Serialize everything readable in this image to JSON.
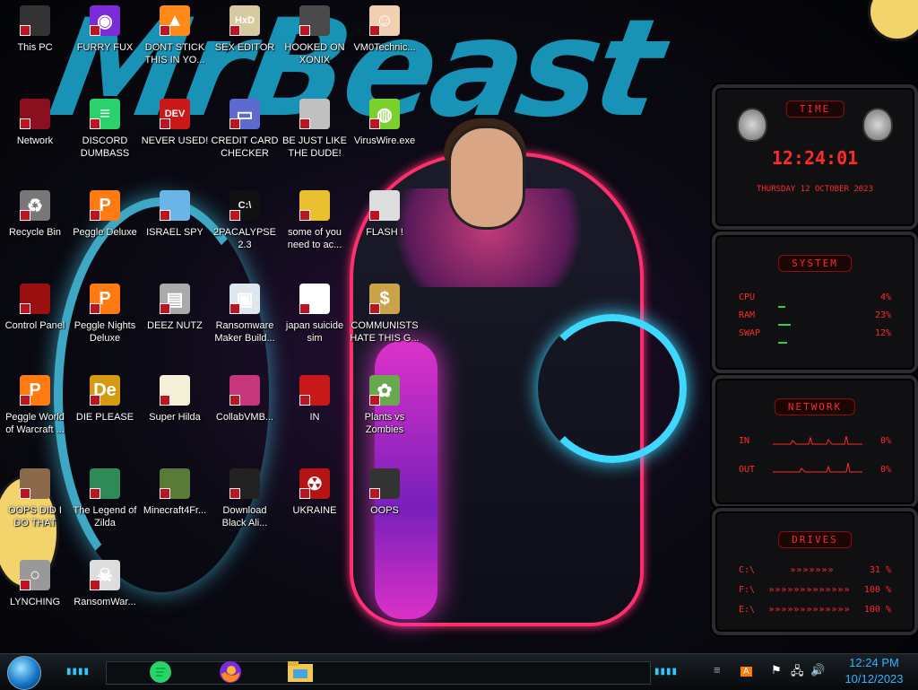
{
  "wallpaper": {
    "brand_text": "MrBeast"
  },
  "desktop_icons": [
    {
      "label": "This PC",
      "icon": "computer-icon"
    },
    {
      "label": "FURRY FUX",
      "icon": "firefox-icon"
    },
    {
      "label": "DONT STICK THIS IN YO...",
      "icon": "vlc-cone-icon"
    },
    {
      "label": "SEX EDITOR",
      "icon": "hxd-editor-icon"
    },
    {
      "label": "HOOKED ON XONIX",
      "icon": "xonix-game-icon"
    },
    {
      "label": "VM0Technic...",
      "icon": "technician-person-icon"
    },
    {
      "label": "Network",
      "icon": "network-globe-icon"
    },
    {
      "label": "DISCORD DUMBASS",
      "icon": "green-chat-icon"
    },
    {
      "label": "NEVER USED!",
      "icon": "devcpp-icon"
    },
    {
      "label": "CREDIT CARD CHECKER",
      "icon": "credit-card-icon"
    },
    {
      "label": "BE JUST LIKE THE DUDE!",
      "icon": "santa-face-icon"
    },
    {
      "label": "VirusWire.exe",
      "icon": "lime-wire-icon"
    },
    {
      "label": "Recycle Bin",
      "icon": "recycle-bin-icon"
    },
    {
      "label": "Peggle Deluxe",
      "icon": "peggle-icon"
    },
    {
      "label": "ISRAEL SPY",
      "icon": "spy-tool-icon"
    },
    {
      "label": "2PACALYPSE 2.3",
      "icon": "terminal-icon"
    },
    {
      "label": "some of you need to ac...",
      "icon": "beaver-icon"
    },
    {
      "label": "FLASH !",
      "icon": "flash-doc-icon"
    },
    {
      "label": "Control Panel",
      "icon": "control-panel-icon"
    },
    {
      "label": "Peggle Nights Deluxe",
      "icon": "peggle-icon"
    },
    {
      "label": "DEEZ NUTZ",
      "icon": "windows-stack-icon"
    },
    {
      "label": "Ransomware Maker Build...",
      "icon": "app-window-icon"
    },
    {
      "label": "japan suicide sim",
      "icon": "document-icon"
    },
    {
      "label": "COMMUNISTS HATE THIS G...",
      "icon": "money-bag-icon"
    },
    {
      "label": "Peggle World of Warcraft ...",
      "icon": "peggle-icon"
    },
    {
      "label": "DIE PLEASE",
      "icon": "de-app-icon"
    },
    {
      "label": "Super Hilda",
      "icon": "pixel-game-icon"
    },
    {
      "label": "CollabVMB...",
      "icon": "collabvm-icon"
    },
    {
      "label": "IN",
      "icon": "red-ball-icon"
    },
    {
      "label": "Plants vs Zombies",
      "icon": "plant-icon"
    },
    {
      "label": "OOPS DID I DO THAT",
      "icon": "portrait-painting-icon"
    },
    {
      "label": "The Legend of Zilda",
      "icon": "zelda-sprite-icon"
    },
    {
      "label": "Minecraft4Fr...",
      "icon": "minecraft-block-icon"
    },
    {
      "label": "Download Black Ali...",
      "icon": "black-alien-icon"
    },
    {
      "label": "UKRAINE",
      "icon": "radiation-icon"
    },
    {
      "label": "OOPS",
      "icon": "oops-monitor-icon"
    },
    {
      "label": "LYNCHING",
      "icon": "noose-icon"
    },
    {
      "label": "RansomWar...",
      "icon": "skull-icon"
    }
  ],
  "widgets": {
    "time": {
      "title": "TIME",
      "time": "12:24:01",
      "date": "THURSDAY 12 OCTOBER 2023"
    },
    "system": {
      "title": "SYSTEM",
      "rows": [
        {
          "label": "CPU",
          "value": "4%"
        },
        {
          "label": "RAM",
          "value": "23%"
        },
        {
          "label": "SWAP",
          "value": "12%"
        }
      ]
    },
    "network": {
      "title": "NETWORK",
      "rows": [
        {
          "label": "IN",
          "value": "0%"
        },
        {
          "label": "OUT",
          "value": "0%"
        }
      ]
    },
    "drives": {
      "title": "DRIVES",
      "rows": [
        {
          "label": "C:\\",
          "value": "31 %"
        },
        {
          "label": "F:\\",
          "value": "100 %"
        },
        {
          "label": "E:\\",
          "value": "100 %"
        }
      ]
    }
  },
  "taskbar": {
    "pinned": [
      {
        "name": "chat-app-icon"
      },
      {
        "name": "firefox-icon"
      },
      {
        "name": "file-explorer-icon"
      }
    ],
    "tray_icons": [
      "avast-icon",
      "flag-icon",
      "network-icon",
      "volume-icon"
    ],
    "clock_time": "12:24 PM",
    "clock_date": "10/12/2023"
  },
  "colors": {
    "accent_red": "#ff2a2a",
    "accent_cyan": "#2fb6ff",
    "neon_pink": "#ff37e6"
  }
}
